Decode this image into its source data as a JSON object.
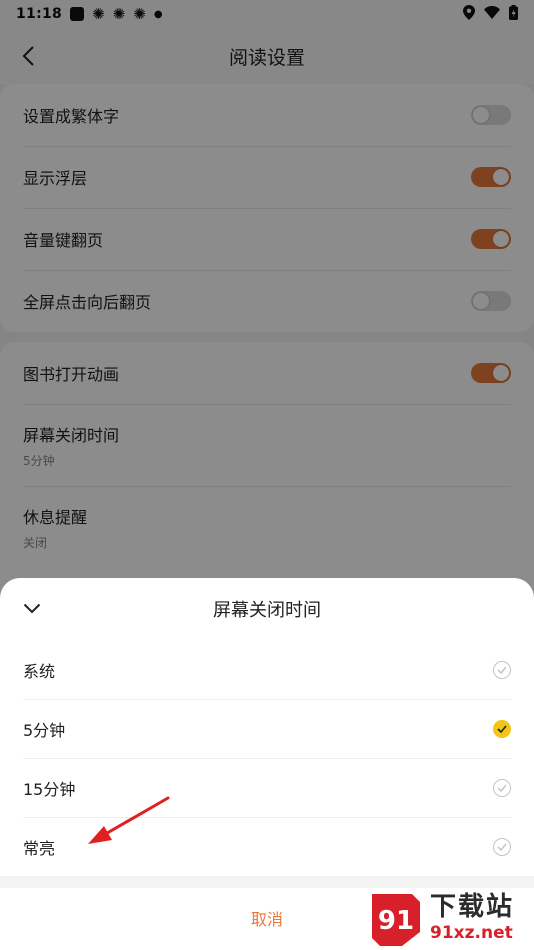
{
  "status_bar": {
    "time": "11:18"
  },
  "header": {
    "title": "阅读设置"
  },
  "settings_group_1": [
    {
      "label": "设置成繁体字",
      "toggle": false
    },
    {
      "label": "显示浮层",
      "toggle": true
    },
    {
      "label": "音量键翻页",
      "toggle": true
    },
    {
      "label": "全屏点击向后翻页",
      "toggle": false
    }
  ],
  "settings_group_2": {
    "book_animation": {
      "label": "图书打开动画",
      "toggle": true
    },
    "screen_timeout": {
      "label": "屏幕关闭时间",
      "value": "5分钟"
    },
    "rest_reminder": {
      "label": "休息提醒",
      "value": "关闭"
    }
  },
  "sheet": {
    "title": "屏幕关闭时间",
    "options": [
      {
        "label": "系统",
        "selected": false
      },
      {
        "label": "5分钟",
        "selected": true
      },
      {
        "label": "15分钟",
        "selected": false
      },
      {
        "label": "常亮",
        "selected": false
      }
    ],
    "cancel_label": "取消"
  },
  "colors": {
    "accent": "#e8793b",
    "selected_check": "#f3c515",
    "annotation_arrow": "#e02020"
  },
  "watermark": {
    "title": "下载站",
    "url": "91xz.net",
    "logo_text": "91"
  }
}
